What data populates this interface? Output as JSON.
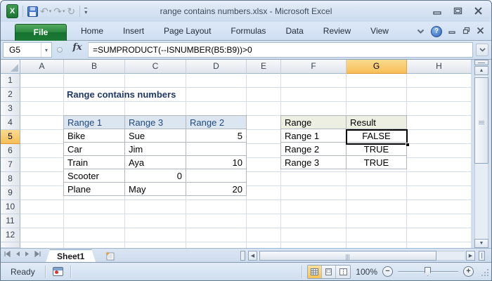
{
  "titlebar": {
    "title": "range contains numbers.xlsx  -  Microsoft Excel",
    "qat_icons": [
      "excel-app-icon",
      "save-icon",
      "undo-icon",
      "redo-icon",
      "repeat-icon",
      "customize-qat-icon"
    ],
    "window_icons": [
      "minimize-icon",
      "restore-icon",
      "close-icon"
    ]
  },
  "ribbon": {
    "file_tab": "File",
    "tabs": [
      "Home",
      "Insert",
      "Page Layout",
      "Formulas",
      "Data",
      "Review",
      "View"
    ],
    "help": "?",
    "right_icons": [
      "minimize-ribbon-icon",
      "help-icon",
      "minimize-icon",
      "restore-icon",
      "close-icon"
    ]
  },
  "formula_bar": {
    "name_box": "G5",
    "fx_label": "fx",
    "formula": "=SUMPRODUCT(--ISNUMBER(B5:B9))>0"
  },
  "sheet": {
    "column_headers": [
      "A",
      "B",
      "C",
      "D",
      "E",
      "F",
      "G",
      "H"
    ],
    "row_headers": [
      "1",
      "2",
      "3",
      "4",
      "5",
      "6",
      "7",
      "8",
      "9",
      "10",
      "11",
      "12"
    ],
    "selected_cell": "G5",
    "selected_column": "G",
    "selected_row": "5",
    "title_text": "Range contains numbers",
    "left_table": {
      "range": "B4:D9",
      "headers": [
        "Range 1",
        "Range 3",
        "Range 2"
      ],
      "rows": [
        [
          "Bike",
          "Sue",
          "5"
        ],
        [
          "Car",
          "Jim",
          ""
        ],
        [
          "Train",
          "Aya",
          "10"
        ],
        [
          "Scooter",
          "0",
          ""
        ],
        [
          "Plane",
          "May",
          "20"
        ]
      ]
    },
    "right_table": {
      "range": "F4:G7",
      "headers": [
        "Range",
        "Result"
      ],
      "rows": [
        [
          "Range 1",
          "FALSE"
        ],
        [
          "Range 2",
          "TRUE"
        ],
        [
          "Range 3",
          "TRUE"
        ]
      ]
    }
  },
  "sheet_tabs": {
    "tabs": [
      "Sheet1"
    ],
    "active": "Sheet1"
  },
  "status_bar": {
    "mode": "Ready",
    "zoom_level": "100%"
  },
  "colors": {
    "file_tab_green": "#1b7b36",
    "header_highlight": "#f6bf55",
    "table_header_blue_bg": "#dce6f1",
    "table_header_blue_text": "#1f497d",
    "right_table_header_bg": "#edefe2",
    "title_text": "#1f3864",
    "gridline": "#d7dde7"
  }
}
